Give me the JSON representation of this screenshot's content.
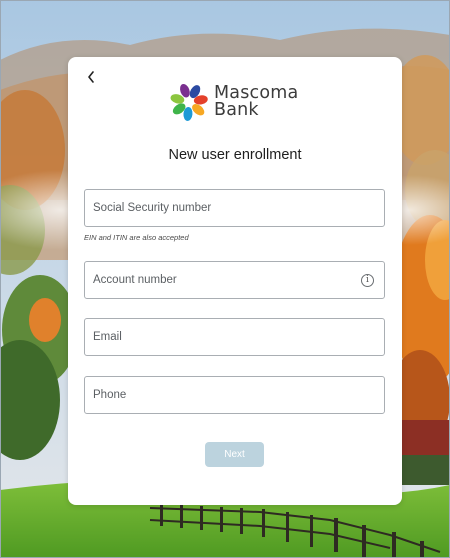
{
  "bank": {
    "name_line1": "Mascoma",
    "name_line2": "Bank",
    "brand_colors": [
      "#2b4aa2",
      "#1d9ad6",
      "#3fb44a",
      "#8cc63f",
      "#f7a823",
      "#e4412b",
      "#7a2f8f"
    ]
  },
  "header": {
    "back_icon": "chevron-left-icon",
    "title": "New user enrollment"
  },
  "form": {
    "ssn": {
      "placeholder": "Social Security number",
      "hint": "EIN and ITIN are also accepted"
    },
    "account": {
      "placeholder": "Account number",
      "info_icon": "info-icon",
      "info_glyph": "i"
    },
    "email": {
      "placeholder": "Email"
    },
    "phone": {
      "placeholder": "Phone"
    },
    "next_label": "Next",
    "next_color": "#bcd3de"
  }
}
